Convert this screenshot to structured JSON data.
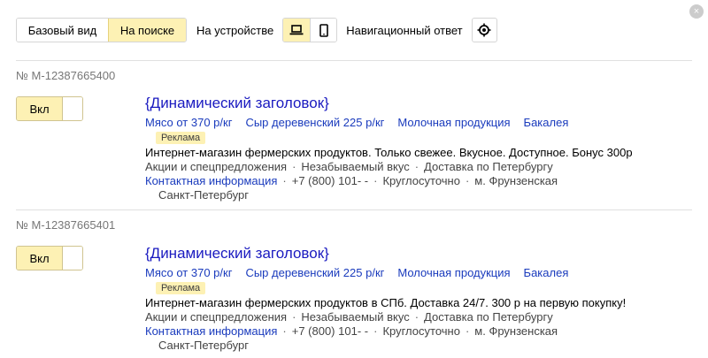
{
  "toolbar": {
    "view_basic": "Базовый вид",
    "view_search": "На поиске",
    "device_label": "На устройстве",
    "nav_label": "Навигационный ответ",
    "close_glyph": "×"
  },
  "ads": [
    {
      "number": "№ M-12387665400",
      "toggle_label": "Вкл",
      "title": "{Динамический заголовок}",
      "sitelinks": [
        "Мясо от 370 р/кг",
        "Сыр деревенский 225 р/кг",
        "Молочная продукция",
        "Бакалея"
      ],
      "badge": "Реклама",
      "text": "Интернет-магазин фермерских продуктов. Только свежее. Вкусное. Доступное. Бонус 300р",
      "callouts": [
        "Акции и спецпредложения",
        "Незабываемый вкус",
        "Доставка по Петербургу"
      ],
      "contact_link": "Контактная информация",
      "phone": "+7 (800) 101-    -",
      "hours": "Круглосуточно",
      "metro": "м. Фрунзенская",
      "city": "Санкт-Петербург"
    },
    {
      "number": "№ M-12387665401",
      "toggle_label": "Вкл",
      "title": "{Динамический заголовок}",
      "sitelinks": [
        "Мясо от 370 р/кг",
        "Сыр деревенский 225 р/кг",
        "Молочная продукция",
        "Бакалея"
      ],
      "badge": "Реклама",
      "text": "Интернет-магазин фермерских продуктов в СПб. Доставка 24/7. 300 р на первую покупку!",
      "callouts": [
        "Акции и спецпредложения",
        "Незабываемый вкус",
        "Доставка по Петербургу"
      ],
      "contact_link": "Контактная информация",
      "phone": "+7 (800) 101-    -",
      "hours": "Круглосуточно",
      "metro": "м. Фрунзенская",
      "city": "Санкт-Петербург"
    }
  ],
  "colors": {
    "accent_yellow": "#fdf1b4",
    "link_blue": "#1a3bbd",
    "title_blue": "#1a1ac0"
  }
}
